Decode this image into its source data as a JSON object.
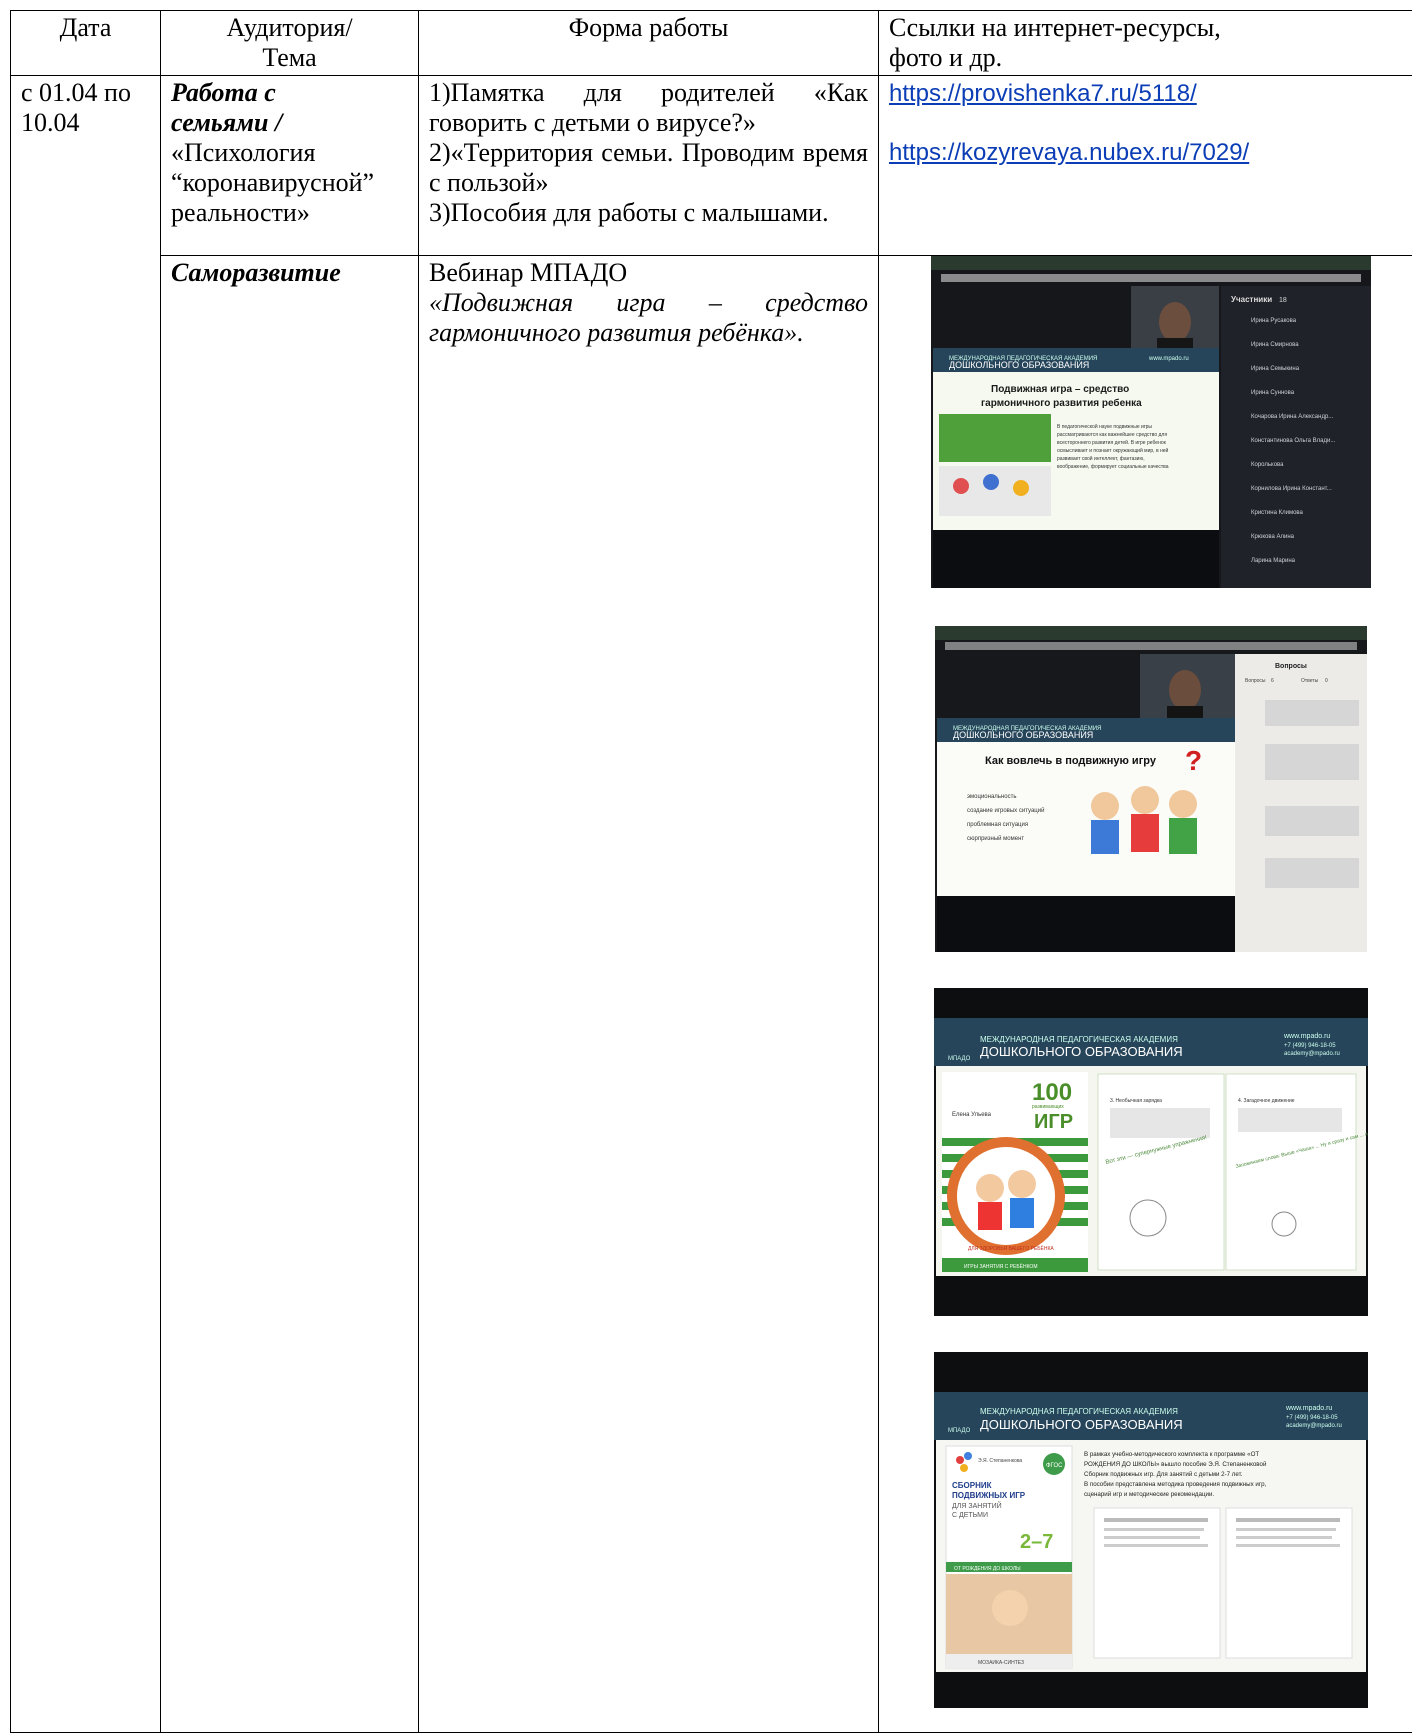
{
  "headers": {
    "date": "Дата",
    "audience": "Аудитория/\nТема",
    "form": "Форма работы",
    "links": "Ссылки на интернет-ресурсы,\nфото и др."
  },
  "row1": {
    "date": "с 01.04 по\n10.04",
    "audience_bold": "Работа с\nсемьями /",
    "audience_text": "«Психология\n“коронавирусной”\nреальности»",
    "form_items": [
      "1)Памятка для родителей «Как говорить с детьми о вирусе?»",
      "2)«Территория семьи. Проводим время с пользой»",
      "3)Пособия для работы с малышами."
    ],
    "links": [
      "https://provishenka7.ru/5118/",
      "https://kozyrevaya.nubex.ru/7029/"
    ]
  },
  "row2": {
    "audience_bold": "Саморазвитие",
    "form_title": "Вебинар МПАДО",
    "form_italic": "«Подвижная игра – средство гармоничного развития ребёнка»."
  },
  "photos": {
    "academy_small": "МЕЖДУНАРОДНАЯ ПЕДАГОГИЧЕСКАЯ АКАДЕМИЯ",
    "academy_big": "ДОШКОЛЬНОГО ОБРАЗОВАНИЯ",
    "site": "www.mpado.ru",
    "phone": "+7 (499) 946-18-05",
    "email": "academy@mpado.ru",
    "logo": "МПАДО",
    "photo1": {
      "participants_title": "Участники",
      "participants_count": "18",
      "slide_title_line1": "Подвижная игра – средство",
      "slide_title_line2": "гармоничного развития ребенка",
      "slide_text": [
        "В педагогической науке подвижные игры",
        "рассматриваются как важнейшее средство для",
        "всестороннего развития детей. В игре ребенок",
        "осмысливает и познает окружающий мир, в ней",
        "развивает свой интеллект, фантазию,",
        "воображение, формирует социальные качества"
      ],
      "participants": [
        "Ирина Русакова",
        "Ирина Смирнова",
        "Ирина Семыкина",
        "Ирина Суннова",
        "Кочарова Ирина Александр...",
        "Константинова Ольга Влади...",
        "Королькова",
        "Корнилова Ирина Констант...",
        "Кристина Климова",
        "Крюкова Алина",
        "Ларина Марина"
      ]
    },
    "photo2": {
      "questions_title": "Вопросы",
      "tab1": "Вопросы",
      "tab1_count": "6",
      "tab2": "Ответы",
      "tab2_count": "0",
      "slide_title": "Как вовлечь в подвижную игру",
      "bullets": [
        "эмоциональность",
        "создание игровых ситуаций",
        "проблемная ситуация",
        "сюрпризный момент"
      ]
    },
    "photo3": {
      "book_number": "100",
      "book_small": "развивающих",
      "book_word": "ИГР",
      "book_author": "Елена Ульева",
      "book_ring": "ДЛЯ ЗДОРОВЬЯ ВАШЕГО РЕБЁНКА",
      "book_footer": "ИГРЫ ЗАНЯТИЯ С РЕБЁНКОМ",
      "page1_heading": "3. Необычная зарядка",
      "page2_heading": "4. Загадочное движение",
      "page1_hand": "Вот эти — супернужные упражнения!",
      "page2_hand": "Запоминаем слова: Выше «Чаша» ... Ну и сразу и сам ... и сразу вылетаю!"
    },
    "photo4": {
      "author": "Э.Я. Степаненкова",
      "badge": "ФГОС",
      "book_title_1": "СБОРНИК",
      "book_title_2": "ПОДВИЖНЫХ ИГР",
      "book_sub_1": "ДЛЯ ЗАНЯТИЙ",
      "book_sub_2": "С ДЕТЬМИ",
      "age": "2–7",
      "series": "ОТ РОЖДЕНИЯ ДО ШКОЛЫ",
      "publisher": "МОЗАИКА-СИНТЕЗ",
      "text": [
        "В рамках учебно-методического комплекта к программе «ОТ",
        "РОЖДЕНИЯ ДО ШКОЛЫ» вышло пособие Э.Я. Степаненковой",
        "Сборник подвижных игр. Для занятий с детьми 2-7 лет.",
        "В пособии представлена методика проведения подвижных игр,",
        "сценарий игр и методические рекомендации."
      ]
    }
  }
}
